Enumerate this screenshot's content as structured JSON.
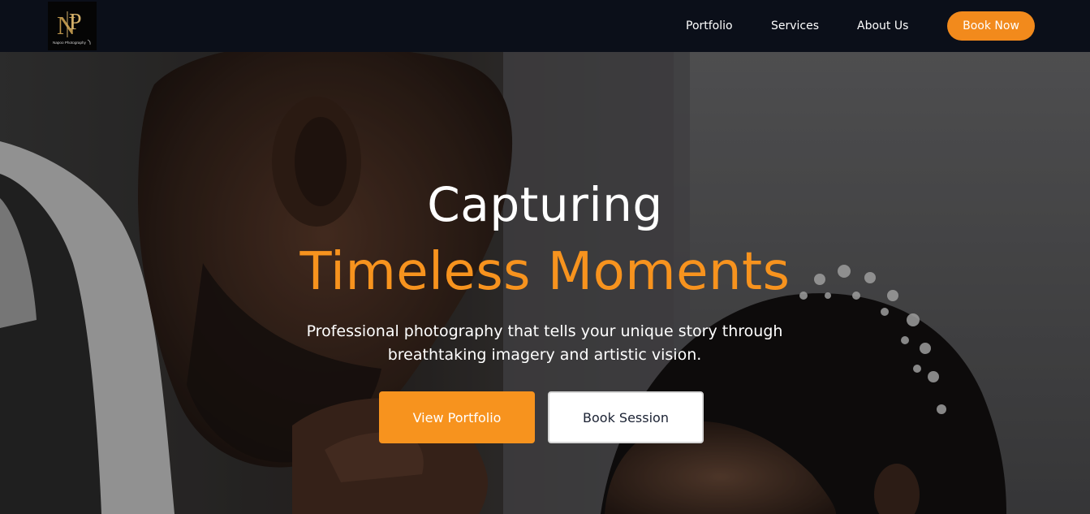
{
  "brand": {
    "logo_name": "Napoo Photography",
    "logo_monogram": "NP"
  },
  "nav": {
    "items": [
      {
        "label": "Portfolio"
      },
      {
        "label": "Services"
      },
      {
        "label": "About Us"
      }
    ],
    "cta_label": "Book Now"
  },
  "hero": {
    "title_line1": "Capturing",
    "title_line2": "Timeless Moments",
    "subtitle": "Professional photography that tells your unique story through breathtaking imagery and artistic vision.",
    "primary_button": "View Portfolio",
    "secondary_button": "Book Session"
  },
  "colors": {
    "accent": "#f7931e",
    "nav_bg": "#0b0f19",
    "text_light": "#ffffff"
  }
}
